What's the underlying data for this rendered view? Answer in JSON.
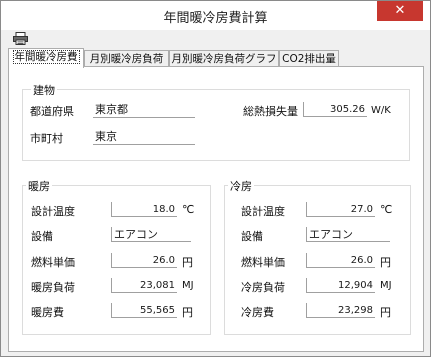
{
  "window": {
    "title": "年間暖冷房費計算",
    "close": "✕"
  },
  "toolbar": {
    "print_icon": "printer-icon"
  },
  "tabs": [
    {
      "label": "年間暖冷房費",
      "active": true
    },
    {
      "label": "月別暖冷房負荷",
      "active": false
    },
    {
      "label": "月別暖冷房負荷グラフ",
      "active": false
    },
    {
      "label": "CO2排出量",
      "active": false
    }
  ],
  "building": {
    "title": "建物",
    "prefecture_label": "都道府県",
    "prefecture_value": "東京都",
    "city_label": "市町村",
    "city_value": "東京",
    "heat_loss_label": "総熱損失量",
    "heat_loss_value": "305.26",
    "heat_loss_unit": "W/K"
  },
  "heating": {
    "title": "暖房",
    "temp_label": "設計温度",
    "temp_value": "18.0",
    "temp_unit": "℃",
    "equip_label": "設備",
    "equip_value": "エアコン",
    "fuel_price_label": "燃料単価",
    "fuel_price_value": "26.0",
    "fuel_price_unit": "円",
    "load_label": "暖房負荷",
    "load_value": "23,081",
    "load_unit": "MJ",
    "cost_label": "暖房費",
    "cost_value": "55,565",
    "cost_unit": "円"
  },
  "cooling": {
    "title": "冷房",
    "temp_label": "設計温度",
    "temp_value": "27.0",
    "temp_unit": "℃",
    "equip_label": "設備",
    "equip_value": "エアコン",
    "fuel_price_label": "燃料単価",
    "fuel_price_value": "26.0",
    "fuel_price_unit": "円",
    "load_label": "冷房負荷",
    "load_value": "12,904",
    "load_unit": "MJ",
    "cost_label": "冷房費",
    "cost_value": "23,298",
    "cost_unit": "円"
  }
}
